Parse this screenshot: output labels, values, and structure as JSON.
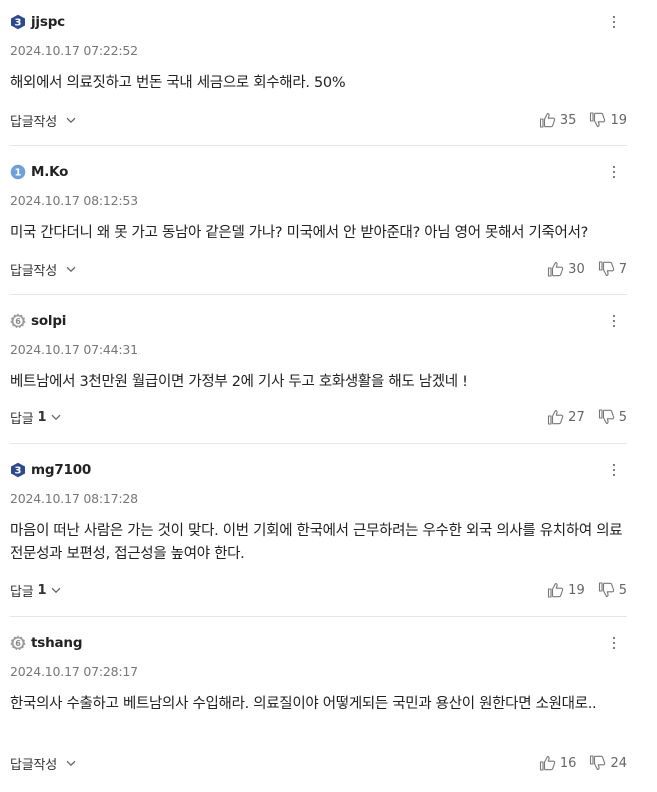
{
  "comments": [
    {
      "badge": "3",
      "badge_style": "blue-shield",
      "username": "jjspc",
      "date": "2024.10.17 07:22:52",
      "text": "해외에서 의료짓하고 번돈 국내 세금으로 회수해라. 50%",
      "reply_label": "답글작성",
      "reply_count": "",
      "likes": "35",
      "dislikes": "19"
    },
    {
      "badge": "1",
      "badge_style": "light-blue-circle",
      "username": "M.Ko",
      "date": "2024.10.17 08:12:53",
      "text": "미국 간다더니 왜 못 가고 동남아 같은델 가나? 미국에서 안 받아준대? 아님 영어 못해서 기죽어서?",
      "reply_label": "답글작성",
      "reply_count": "",
      "likes": "30",
      "dislikes": "7"
    },
    {
      "badge": "6",
      "badge_style": "gray-gear",
      "username": "solpi",
      "date": "2024.10.17 07:44:31",
      "text": "베트남에서 3천만원 월급이면 가정부 2에 기사 두고 호화생활을 해도 남겠네 !",
      "reply_label": "답글",
      "reply_count": "1",
      "likes": "27",
      "dislikes": "5"
    },
    {
      "badge": "3",
      "badge_style": "blue-shield",
      "username": "mg7100",
      "date": "2024.10.17 08:17:28",
      "text": "마음이 떠난 사람은 가는 것이 맞다. 이번 기회에 한국에서 근무하려는 우수한 외국 의사를 유치하여 의료 전문성과 보편성, 접근성을 높여야 한다.",
      "reply_label": "답글",
      "reply_count": "1",
      "likes": "19",
      "dislikes": "5"
    },
    {
      "badge": "6",
      "badge_style": "gray-gear",
      "username": "tshang",
      "date": "2024.10.17 07:28:17",
      "text": "한국의사 수출하고 베트남의사 수입해라. 의료질이야 어떻게되든 국민과 용산이 원한다면 소원대로..",
      "reply_label": "답글작성",
      "reply_count": "",
      "likes": "16",
      "dislikes": "24"
    }
  ],
  "colors": {
    "blue_shield": "#2f4a8c",
    "light_blue_circle": "#6fa0d8",
    "gray_gear": "#9a9a9a",
    "divider": "#e6e6e6"
  },
  "icons": {
    "more": "vertical-ellipsis-icon",
    "reply_toggle": "chevron-down-icon",
    "like": "thumbs-up-icon",
    "dislike": "thumbs-down-icon"
  }
}
